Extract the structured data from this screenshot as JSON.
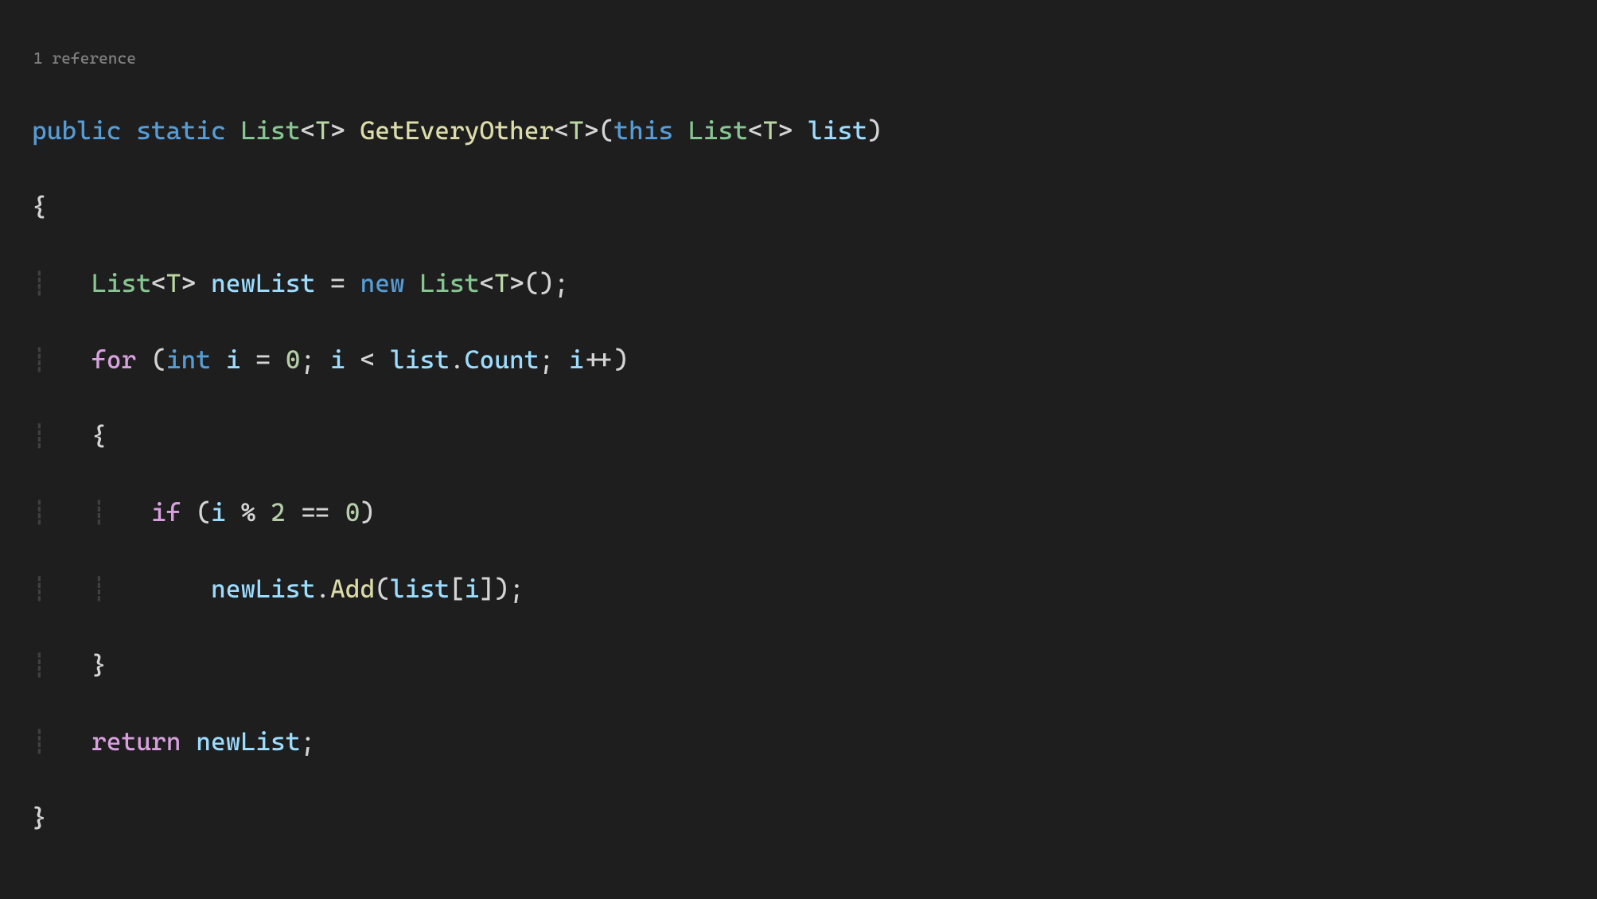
{
  "codelens": "1 reference",
  "kw": {
    "public": "public",
    "static": "static",
    "this": "this",
    "new": "new",
    "int": "int"
  },
  "flow": {
    "for": "for",
    "if": "if",
    "return": "return"
  },
  "type": {
    "List": "List"
  },
  "typeparam": {
    "T": "T"
  },
  "method": {
    "GetEveryOther": "GetEveryOther",
    "Add": "Add"
  },
  "var": {
    "list": "list",
    "newList": "newList",
    "i": "i",
    "Count": "Count"
  },
  "num": {
    "zero": "0",
    "two": "2"
  }
}
